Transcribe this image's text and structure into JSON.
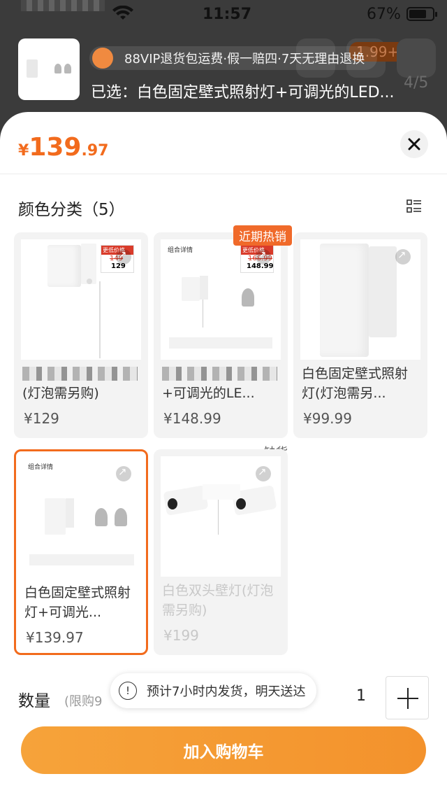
{
  "status_bar": {
    "time": "11:57",
    "battery": "67%"
  },
  "header": {
    "vip_text": "88VIP退货包运费·假一赔四·7天无理由退换",
    "selected_text": "已选：白色固定壁式照射灯+可调光的LED...",
    "cart_badge": "1.99+",
    "page_indicator": "4/5"
  },
  "sheet": {
    "price": {
      "currency": "¥",
      "integer": "139",
      "decimal": ".97"
    },
    "section_title": "颜色分类（5）",
    "hot_badge": "近期热销",
    "out_of_stock": "缺货",
    "items": [
      {
        "name": "(灯泡需另购)",
        "price": "¥129",
        "tag_label": "更低价格",
        "tag_old": "149",
        "tag_new": "129"
      },
      {
        "name": "+可调光的LE...",
        "price": "¥148.99",
        "tag_label": "更低价格",
        "tag_old": "168.99",
        "tag_new": "148.99",
        "img_title": "组合详情"
      },
      {
        "name": "白色固定壁式照射灯(灯泡需另...",
        "price": "¥99.99"
      },
      {
        "name": "白色固定壁式照射灯+可调光...",
        "price": "¥139.97",
        "img_title": "组合详情"
      },
      {
        "name": "白色双头壁灯(灯泡需另购)",
        "price": "¥199"
      }
    ],
    "quantity_label": "数量",
    "quantity_limit": "(限购9",
    "quantity_value": "1",
    "toast": "预计7小时内发货，明天送达",
    "cart_button": "加入购物车"
  }
}
